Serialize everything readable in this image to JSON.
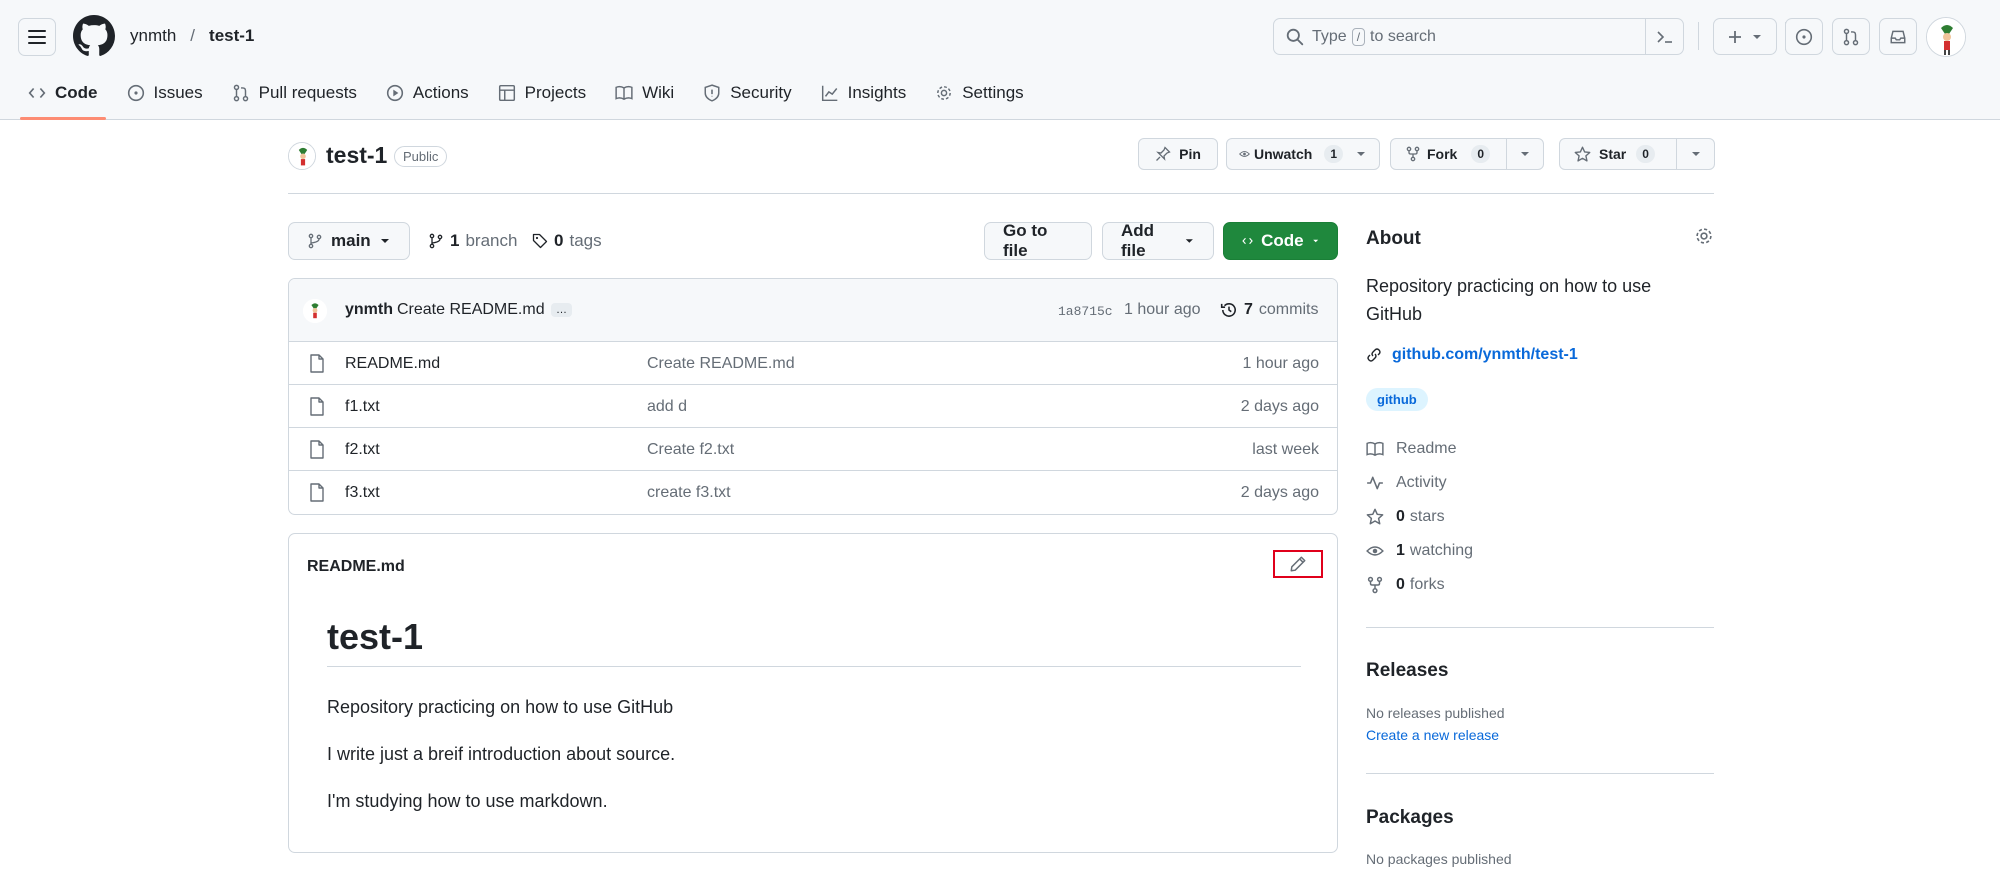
{
  "header": {
    "owner": "ynmth",
    "separator": "/",
    "repo": "test-1",
    "search_prefix": "Type",
    "search_key": "/",
    "search_suffix": "to search"
  },
  "tabs": [
    {
      "label": "Code",
      "icon": "code-icon"
    },
    {
      "label": "Issues",
      "icon": "issue-icon"
    },
    {
      "label": "Pull requests",
      "icon": "pull-request-icon"
    },
    {
      "label": "Actions",
      "icon": "play-icon"
    },
    {
      "label": "Projects",
      "icon": "table-icon"
    },
    {
      "label": "Wiki",
      "icon": "book-icon"
    },
    {
      "label": "Security",
      "icon": "shield-icon"
    },
    {
      "label": "Insights",
      "icon": "graph-icon"
    },
    {
      "label": "Settings",
      "icon": "gear-icon"
    }
  ],
  "repo_header": {
    "name": "test-1",
    "visibility": "Public",
    "pin_label": "Pin",
    "unwatch_label": "Unwatch",
    "watch_count": "1",
    "fork_label": "Fork",
    "fork_count": "0",
    "star_label": "Star",
    "star_count": "0"
  },
  "branchbar": {
    "branch": "main",
    "branch_count": "1",
    "branch_word": "branch",
    "tag_count": "0",
    "tag_word": "tags",
    "go_to_file": "Go to file",
    "add_file": "Add file",
    "code": "Code"
  },
  "commit": {
    "user": "ynmth",
    "message": "Create README.md",
    "more": "…",
    "sha": "1a8715c",
    "time": "1 hour ago",
    "count": "7",
    "count_word": "commits"
  },
  "files": [
    {
      "name": "README.md",
      "message": "Create README.md",
      "time": "1 hour ago"
    },
    {
      "name": "f1.txt",
      "message": "add d",
      "time": "2 days ago"
    },
    {
      "name": "f2.txt",
      "message": "Create f2.txt",
      "time": "last week"
    },
    {
      "name": "f3.txt",
      "message": "create f3.txt",
      "time": "2 days ago"
    }
  ],
  "readme": {
    "file_title": "README.md",
    "heading": "test-1",
    "paragraphs": [
      "Repository practicing on how to use GitHub",
      "I write just a breif introduction about source.",
      "I'm studying how to use markdown."
    ]
  },
  "about": {
    "heading": "About",
    "description": "Repository practicing on how to use GitHub",
    "link": "github.com/ynmth/test-1",
    "topic": "github",
    "readme": "Readme",
    "activity": "Activity",
    "stars_count": "0",
    "stars_word": "stars",
    "watching_count": "1",
    "watching_word": "watching",
    "forks_count": "0",
    "forks_word": "forks"
  },
  "releases": {
    "heading": "Releases",
    "none": "No releases published",
    "create": "Create a new release"
  },
  "packages": {
    "heading": "Packages",
    "none": "No packages published"
  },
  "colors": {
    "accent_green": "#1f883d",
    "link_blue": "#0969da",
    "tab_underline": "#fd8c73",
    "highlight_box": "#e0001b"
  }
}
